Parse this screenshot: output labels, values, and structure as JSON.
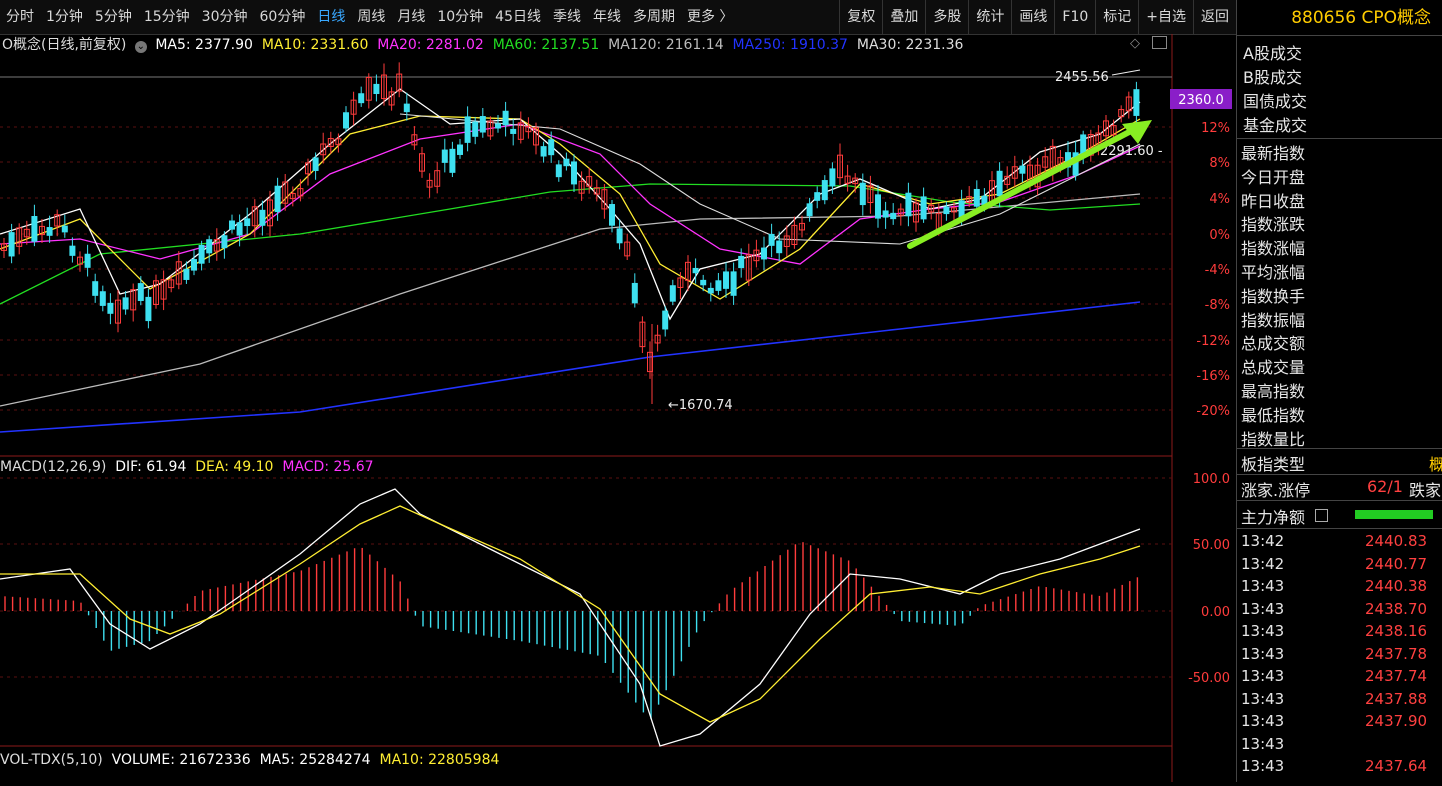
{
  "toolbar": {
    "periods": [
      "分时",
      "1分钟",
      "5分钟",
      "15分钟",
      "30分钟",
      "60分钟",
      "日线",
      "周线",
      "月线",
      "10分钟",
      "45日线",
      "季线",
      "年线",
      "多周期",
      "更多 〉"
    ],
    "active_index": 6,
    "tools": [
      "复权",
      "叠加",
      "多股",
      "统计",
      "画线",
      "F10",
      "标记",
      "+自选",
      "返回"
    ]
  },
  "main_legend": {
    "title": "O概念(日线,前复权)",
    "ma5": "MA5: 2377.90",
    "ma10": "MA10: 2331.60",
    "ma20": "MA20: 2281.02",
    "ma60": "MA60: 2137.51",
    "ma120": "MA120: 2161.14",
    "ma250": "MA250: 1910.37",
    "ma30": "MA30: 2231.36"
  },
  "annotations": {
    "high": "2455.56",
    "low": "1670.74",
    "current_price": "2360.0",
    "level_right": "2291.60 -"
  },
  "price_axis": [
    "12%",
    "8%",
    "4%",
    "0%",
    "-4%",
    "-8%",
    "-12%",
    "-16%",
    "-20%"
  ],
  "macd": {
    "label": "MACD(12,26,9)",
    "dif": "DIF: 61.94",
    "dea": "DEA: 49.10",
    "macd": "MACD: 25.67",
    "axis": [
      "100.0",
      "50.00",
      "0.00",
      "-50.00"
    ]
  },
  "volume": {
    "label": "VOL-TDX(5,10)",
    "volume": "VOLUME: 21672336",
    "ma5": "MA5: 25284274",
    "ma10": "MA10: 22805984"
  },
  "sidebar": {
    "title": "880656 CPO概念",
    "fields_a": [
      "A股成交",
      "B股成交",
      "国债成交",
      "基金成交"
    ],
    "fields_b": [
      "最新指数",
      "今日开盘",
      "昨日收盘",
      "指数涨跌",
      "指数涨幅",
      "平均涨幅",
      "指数换手",
      "指数振幅",
      "总成交额",
      "总成交量",
      "最高指数",
      "最低指数",
      "指数量比"
    ],
    "board_type_label": "板指类型",
    "board_type_value": "概",
    "limit_label": "涨家.涨停",
    "limit_value": "62/1",
    "limit_suffix": "跌家",
    "net_flow_label": "主力净额",
    "ticks": [
      {
        "time": "13:42",
        "value": "2440.83"
      },
      {
        "time": "13:42",
        "value": "2440.77"
      },
      {
        "time": "13:43",
        "value": "2440.38"
      },
      {
        "time": "13:43",
        "value": "2438.70"
      },
      {
        "time": "13:43",
        "value": "2438.16"
      },
      {
        "time": "13:43",
        "value": "2437.78"
      },
      {
        "time": "13:43",
        "value": "2437.74"
      },
      {
        "time": "13:43",
        "value": "2437.88"
      },
      {
        "time": "13:43",
        "value": "2437.90"
      },
      {
        "time": "13:43",
        "value": ""
      },
      {
        "time": "13:43",
        "value": "2437.64"
      }
    ]
  },
  "colors": {
    "up": "#ff3c3c",
    "down": "#3ee0f0",
    "ma5": "#ffffff",
    "ma10": "#ffee33",
    "ma20": "#ff33ff",
    "ma60": "#22dd22",
    "ma120": "#bbbbbb",
    "ma250": "#2233ff",
    "arrow": "#88ee22",
    "accent": "#39a8ff"
  }
}
